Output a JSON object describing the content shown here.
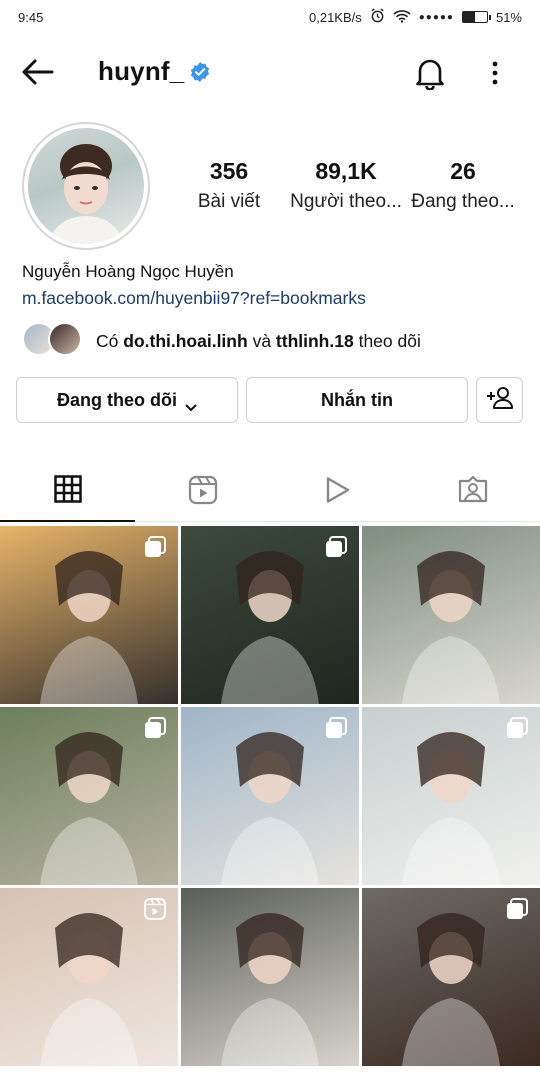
{
  "status_bar": {
    "time": "9:45",
    "net_speed": "0,21KB/s",
    "battery": "51%",
    "battery_level": 0.51
  },
  "header": {
    "username": "huynf_",
    "verified": true,
    "icons": [
      "back-arrow-icon",
      "verified-badge-icon",
      "bell-icon",
      "more-vertical-icon"
    ]
  },
  "profile": {
    "stats": [
      {
        "value": "356",
        "label": "Bài viết"
      },
      {
        "value": "89,1K",
        "label": "Người theo..."
      },
      {
        "value": "26",
        "label": "Đang theo..."
      }
    ],
    "full_name": "Nguyễn Hoàng Ngọc Huyền",
    "link": "m.facebook.com/huyenbii97?ref=bookmarks",
    "mutual": {
      "prefix": "Có",
      "user1": "do.thi.hoai.linh",
      "joiner": "và",
      "user2": "tthlinh.18",
      "suffix": "theo dõi"
    }
  },
  "actions": {
    "following_label": "Đang theo dõi",
    "message_label": "Nhắn tin"
  },
  "tabs": [
    {
      "name": "grid",
      "icon": "grid-icon",
      "active": true
    },
    {
      "name": "reels",
      "icon": "reels-icon",
      "active": false
    },
    {
      "name": "videos",
      "icon": "play-icon",
      "active": false
    },
    {
      "name": "tagged",
      "icon": "tagged-person-icon",
      "active": false
    }
  ],
  "colors": {
    "verified_blue": "#3897f0",
    "link": "#1e3b69",
    "border": "#d0d0d0"
  },
  "posts": [
    {
      "overlay": "multi-photo-icon",
      "palette": [
        "#e7b46a",
        "#35302c"
      ]
    },
    {
      "overlay": "multi-photo-icon",
      "palette": [
        "#3d4a3c",
        "#1f2620"
      ]
    },
    {
      "overlay": "none",
      "palette": [
        "#7e8e7f",
        "#d9d6cf"
      ]
    },
    {
      "overlay": "multi-photo-icon",
      "palette": [
        "#6c7f5b",
        "#b8b2a2"
      ]
    },
    {
      "overlay": "multi-photo-icon",
      "palette": [
        "#9fb5c8",
        "#e6e3de"
      ]
    },
    {
      "overlay": "multi-photo-icon",
      "palette": [
        "#c7cfcf",
        "#f1f1ef"
      ]
    },
    {
      "overlay": "reels-icon",
      "palette": [
        "#d6c2b3",
        "#efe6df"
      ]
    },
    {
      "overlay": "none",
      "palette": [
        "#5a5e58",
        "#d8d4cc"
      ]
    },
    {
      "overlay": "multi-photo-icon",
      "palette": [
        "#6e6a66",
        "#3b2a22"
      ]
    }
  ]
}
